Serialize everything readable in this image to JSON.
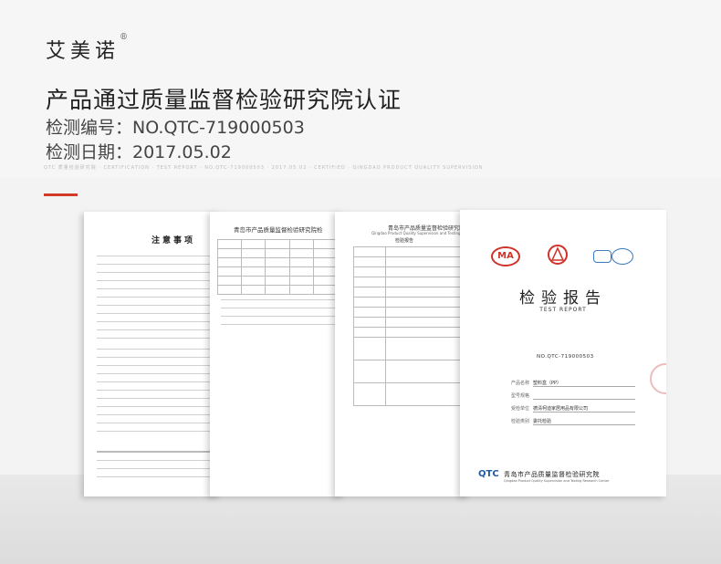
{
  "brand": {
    "name": "艾美诺",
    "mark": "®"
  },
  "headline": "产品通过质量监督检验研究院认证",
  "report_number_line": "检测编号：NO.QTC-719000503",
  "report_date_line": "检测日期：2017.05.02",
  "faint_caption": "QTC 质量检验研究院 · CERTIFICATION · TEST REPORT · NO.QTC-719000503 · 2017.05.02 · CERTIFIED · QINGDAO PRODUCT QUALITY SUPERVISION",
  "notice_sheet": {
    "title": "注意事项"
  },
  "results_sheet": {
    "title": "青岛市产品质量监督检验研究院检"
  },
  "info_sheet": {
    "title": "青岛市产品质量监督检验研究院",
    "subtitle": "Qingdao Product Quality Supervision and Testing",
    "caption": "检验报告"
  },
  "cover_sheet": {
    "cma": "MA",
    "title": "检验报告",
    "subtitle": "TEST REPORT",
    "report_no": "NO.QTC-719000503",
    "fields": [
      {
        "label": "产品名称",
        "value": "塑料盒（PP）"
      },
      {
        "label": "型号规格",
        "value": ""
      },
      {
        "label": "受检单位",
        "value": "德清柯迪家居用品有限公司"
      },
      {
        "label": "检验类别",
        "value": "委托检验"
      }
    ],
    "footer_logo": "QTC",
    "footer_cn": "青岛市产品质量监督检验研究院",
    "footer_en": "Qingdao Product Quality Supervision and Testing Research Center"
  },
  "colors": {
    "accent": "#d23a2a",
    "seal_red": "#d0322a",
    "seal_blue": "#3b7bbf"
  }
}
